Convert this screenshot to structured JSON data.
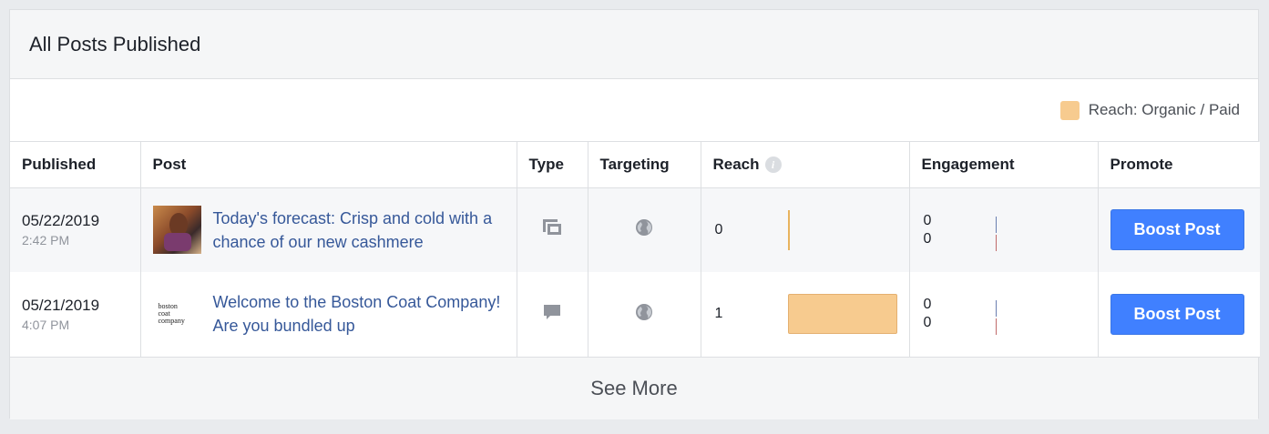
{
  "card": {
    "title": "All Posts Published",
    "legend_label": "Reach: Organic / Paid",
    "legend_color": "#f7cb8f"
  },
  "columns": {
    "published": "Published",
    "post": "Post",
    "type": "Type",
    "targeting": "Targeting",
    "reach": "Reach",
    "engagement": "Engagement",
    "promote": "Promote"
  },
  "rows": [
    {
      "date": "05/22/2019",
      "time": "2:42 PM",
      "thumb": "photo",
      "text": "Today's forecast: Crisp and cold with a chance of our new cashmere",
      "type_icon": "album-icon",
      "targeting_icon": "globe-icon",
      "reach": "0",
      "reach_fraction": 0,
      "engagement_1": "0",
      "engagement_2": "0",
      "boost_label": "Boost Post"
    },
    {
      "date": "05/21/2019",
      "time": "4:07 PM",
      "thumb": "logo",
      "logo_lines": [
        "boston",
        "coat",
        "company"
      ],
      "text": "Welcome to the Boston Coat Company! Are you bundled up",
      "type_icon": "status-icon",
      "targeting_icon": "globe-icon",
      "reach": "1",
      "reach_fraction": 1,
      "engagement_1": "0",
      "engagement_2": "0",
      "boost_label": "Boost Post"
    }
  ],
  "see_more": "See More",
  "colors": {
    "boost": "#4080ff",
    "link": "#365899",
    "reach_bar": "#f7cb8f"
  }
}
